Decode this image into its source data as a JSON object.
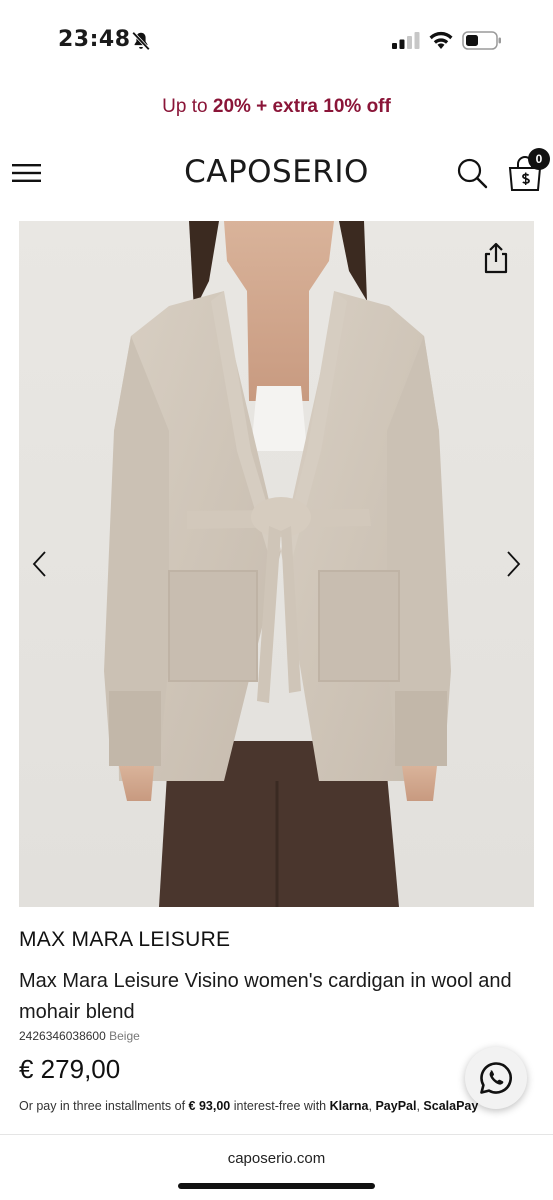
{
  "status_bar": {
    "time": "23:48",
    "icons": [
      "bell-slash-icon",
      "cellular-signal-icon",
      "wifi-icon",
      "battery-icon"
    ]
  },
  "promo": {
    "prefix": "Up to ",
    "highlight": "20% + extra 10% off",
    "color": "#8a1538"
  },
  "header": {
    "logo": "CAPOSERIO",
    "cart_count": "0",
    "icons": [
      "menu-icon",
      "search-icon",
      "shopping-bag-icon"
    ]
  },
  "gallery": {
    "icons": [
      "share-icon",
      "chevron-left-icon",
      "chevron-right-icon"
    ]
  },
  "product": {
    "brand": "MAX MARA LEISURE",
    "title": "Max Mara Leisure Visino women's cardigan in wool and mohair blend",
    "sku": "2426346038600",
    "color": "Beige",
    "price": "€ 279,00",
    "installments": {
      "prefix": "Or pay in three installments of ",
      "amount": "€ 93,00",
      "middle": " interest-free with ",
      "provider1": "Klarna",
      "sep1": ", ",
      "provider2": "PayPal",
      "sep2": ", ",
      "provider3": "ScalaPay"
    }
  },
  "browser": {
    "url": "caposerio.com"
  }
}
